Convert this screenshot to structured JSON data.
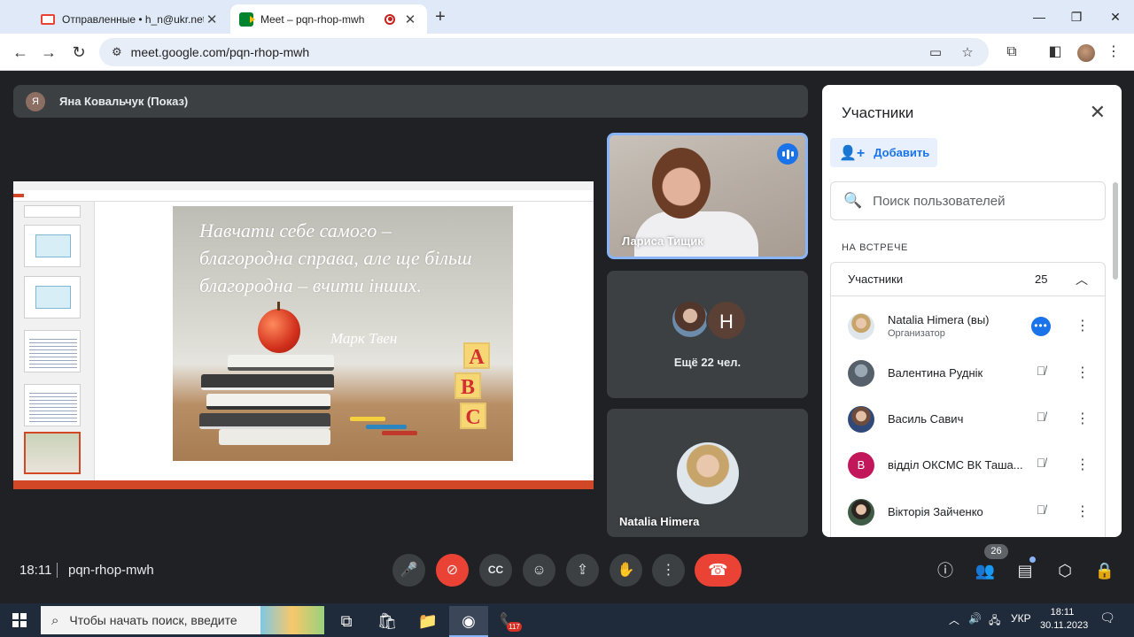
{
  "browser": {
    "tabs": [
      {
        "title": "Отправленные • h_n@ukr.net",
        "icon": "gmail-icon"
      },
      {
        "title": "Meet – pqn-rhop-mwh",
        "icon": "meet-icon",
        "active": true
      }
    ],
    "url": "meet.google.com/pqn-rhop-mwh"
  },
  "meet": {
    "presenter": {
      "initial": "Я",
      "label": "Яна Ковальчук (Показ)"
    },
    "slide": {
      "quote": "Навчати себе самого – благородна справа, але ще більш благородна – вчити інших.",
      "author": "Марк Твен",
      "blocks": [
        "A",
        "B",
        "C"
      ]
    },
    "tiles": {
      "speaker": "Лариса Тищик",
      "more_initial": "Н",
      "more_label": "Ещё 22 чел.",
      "self": "Natalia Himera"
    },
    "time": "18:11",
    "code": "pqn-rhop-mwh",
    "people_badge": "26"
  },
  "panel": {
    "title": "Участники",
    "add_label": "Добавить",
    "search_placeholder": "Поиск пользователей",
    "section": "НА ВСТРЕЧЕ",
    "group_label": "Участники",
    "group_count": "25",
    "participants": [
      {
        "name": "Natalia Himera (вы)",
        "role": "Организатор"
      },
      {
        "name": "Валентина Руднік"
      },
      {
        "name": "Василь Савич"
      },
      {
        "name": "відділ ОКСМС ВК Таша...",
        "initial": "В"
      },
      {
        "name": "Вікторія Зайченко"
      }
    ]
  },
  "taskbar": {
    "search_placeholder": "Чтобы начать поиск, введите",
    "viber_badge": "117",
    "lang": "УКР",
    "time": "18:11",
    "date": "30.11.2023"
  },
  "colors": {
    "meet_bg": "#202124",
    "tile_bg": "#3c4043",
    "accent_blue": "#1a73e8",
    "hangup_red": "#ea4335",
    "speaker_border": "#8ab4f8"
  }
}
